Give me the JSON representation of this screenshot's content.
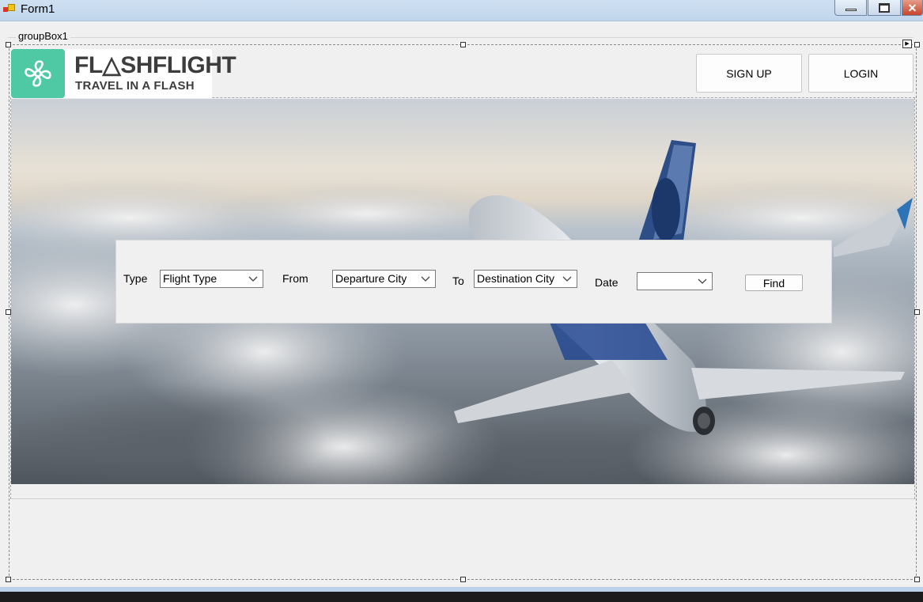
{
  "window": {
    "title": "Form1"
  },
  "groupbox": {
    "label": "groupBox1"
  },
  "logo": {
    "title": "FL△SHFLIGHT",
    "tagline": "TRAVEL IN A FLASH"
  },
  "header": {
    "signup_label": "SIGN UP",
    "login_label": "LOGIN"
  },
  "search": {
    "type_label": "Type",
    "type_value": "Flight Type",
    "from_label": "From",
    "from_value": "Departure City",
    "to_label": "To",
    "to_value": "Destination City",
    "date_label": "Date",
    "date_value": "",
    "find_label": "Find"
  },
  "colors": {
    "brand": "#4fc9a3",
    "titlebar": "#c8dbef",
    "close": "#c8452b"
  },
  "icons": {
    "logo": "propeller-fan-icon",
    "dropdown": "chevron-down-icon"
  }
}
